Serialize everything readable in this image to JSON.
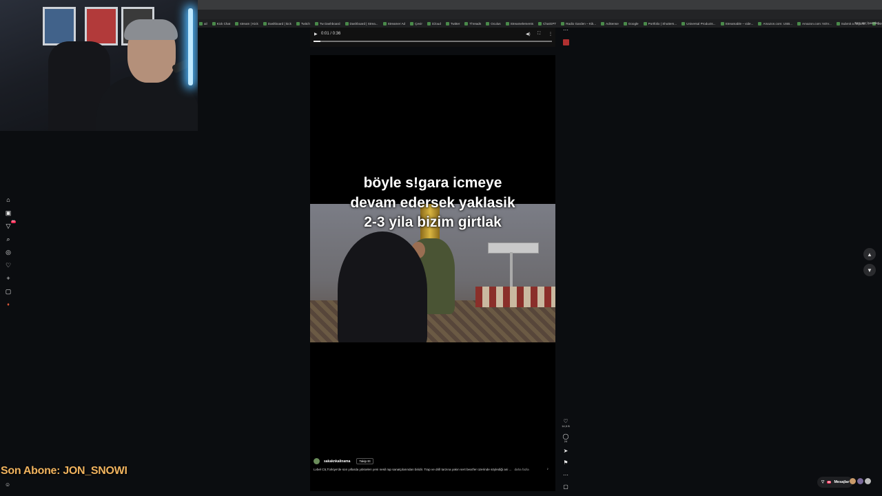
{
  "bookmarks": [
    "ail",
    "Kick Chat",
    "stream | Kick",
    "Dashboard | kick",
    "Twitch",
    "Tw Dashboard",
    "Dashboard | Strea...",
    "Streamer Ad",
    "Çevir",
    "iCloud",
    "Twitter",
    "Threads",
    "Oculus",
    "Streamelements",
    "ChatGPT",
    "Radio Garden – Kik...",
    "AdSense",
    "Google",
    "Portfolio | Shutters...",
    "Universal Products...",
    "Streamable – vide...",
    "Amazon.com: USB...",
    "Amazon.com: NOV...",
    "Submit a request...",
    "Drive & Lists"
  ],
  "bookmarks_end": "Tüm Yer İşaretleri",
  "audio": {
    "time": "0:01 / 0:36",
    "progress": 0.03
  },
  "video": {
    "caption": "böyle s!gara icmeye\ndevam edersek yaklasik\n2-3 yila bizim girtlak"
  },
  "post": {
    "username": "sakaknkalinama",
    "follow_label": "Takip Et",
    "description": "Lvbel C5,Türkiye'de son yıllarda yükselen yeni nesil rap sanatçılarından biridir. Trap ve drill tarzına yakın sert beat'ler üzerinde söylediği ani ...",
    "more_label": "daha fazla"
  },
  "actions": {
    "likes": "14,5 B",
    "comments": "24"
  },
  "left_rail_badge": "99",
  "overlay": {
    "last_sub": "Son Abone: JON_SNOWI"
  },
  "messages": {
    "label": "Mesajlar",
    "badge": "99"
  },
  "icons": [
    "home-icon",
    "video-icon",
    "inbox-icon",
    "search-icon",
    "explore-icon",
    "heart-icon",
    "plus-icon",
    "chat-icon",
    "profile-icon",
    "play-icon",
    "volume-icon",
    "fullscreen-icon",
    "more-icon",
    "comment-icon",
    "share-icon",
    "bookmark-icon",
    "chevron-up-icon",
    "chevron-down-icon"
  ]
}
